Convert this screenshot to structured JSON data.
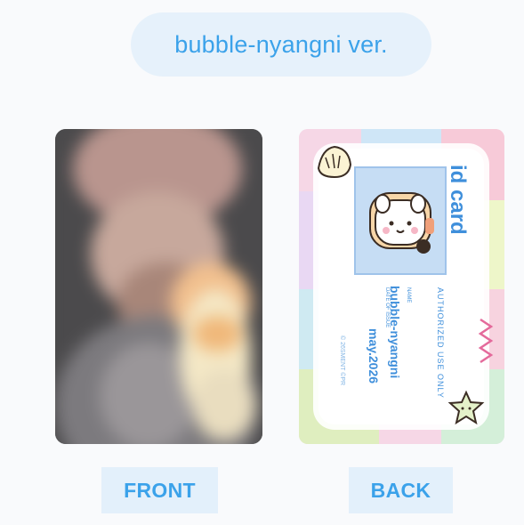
{
  "header": {
    "version_label": "bubble-nyangni ver."
  },
  "front": {
    "button_label": "FRONT"
  },
  "back": {
    "button_label": "BACK",
    "card": {
      "title": "id card",
      "authorized": "AUTHORIZED USE ONLY",
      "name_label": "NAME",
      "name_value": "bubble-nyangni",
      "date_label": "DATE OF ISSUE",
      "date_value": "may.2026",
      "copyright": "© 26SMENT ©PR"
    }
  },
  "colors": {
    "accent": "#3ba2ea",
    "pill_bg": "#e6f1fb",
    "button_bg": "#e3f0fb",
    "card_text": "#3f8fdb"
  }
}
